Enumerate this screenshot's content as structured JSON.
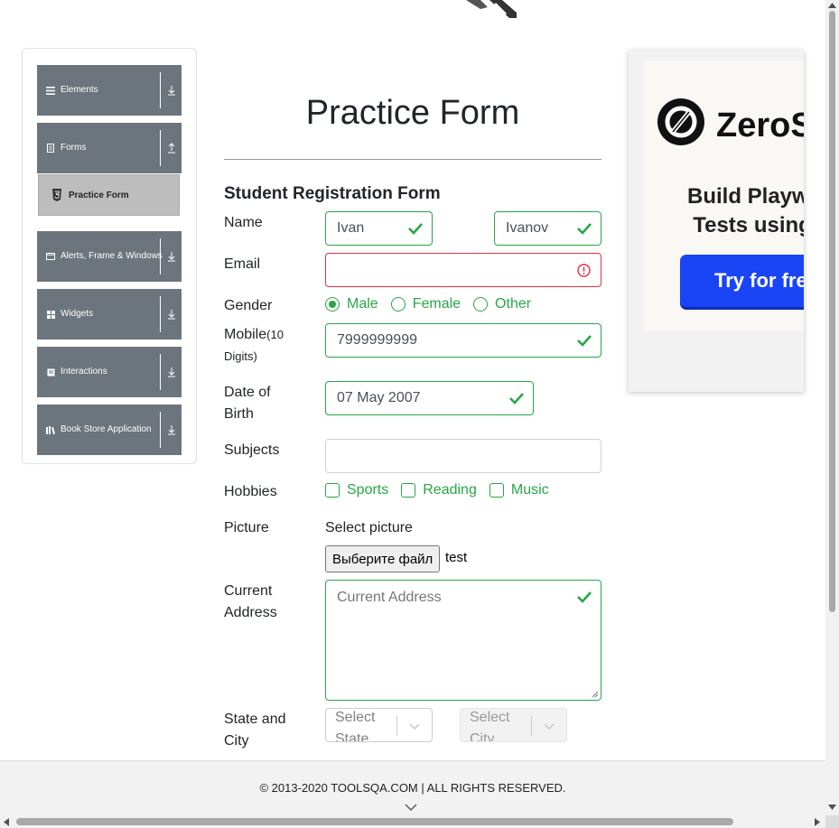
{
  "sidebar": {
    "groups": [
      {
        "label": "Elements",
        "icon": "hamburger-icon",
        "arrow": "down"
      },
      {
        "label": "Forms",
        "icon": "document-icon",
        "arrow": "up"
      },
      {
        "label": "Alerts, Frame & Windows",
        "icon": "window-icon",
        "arrow": "down"
      },
      {
        "label": "Widgets",
        "icon": "grid-icon",
        "arrow": "down"
      },
      {
        "label": "Interactions",
        "icon": "interaction-icon",
        "arrow": "down"
      },
      {
        "label": "Book Store Application",
        "icon": "books-icon",
        "arrow": "down"
      }
    ],
    "active_item": "Practice Form"
  },
  "form": {
    "title": "Practice Form",
    "subtitle": "Student Registration Form",
    "labels": {
      "name": "Name",
      "email": "Email",
      "gender": "Gender",
      "mobile": "Mobile",
      "mobile_hint": "(10 Digits)",
      "dob": "Date of Birth",
      "subjects": "Subjects",
      "hobbies": "Hobbies",
      "picture": "Picture",
      "address": "Current Address",
      "state_city": "State and City"
    },
    "first_name": "Ivan",
    "last_name": "Ivanov",
    "email": "",
    "gender_options": [
      "Male",
      "Female",
      "Other"
    ],
    "gender_selected": "Male",
    "mobile": "7999999999",
    "dob": "07 May 2007",
    "subjects": "",
    "hobbies": [
      "Sports",
      "Reading",
      "Music"
    ],
    "select_picture": "Select picture",
    "file_button": "Выберите файл",
    "file_name": "test",
    "address_placeholder": "Current Address",
    "state_placeholder": "Select State",
    "city_placeholder": "Select City"
  },
  "ad": {
    "brand": "ZeroS",
    "tagline_1": "Build Playwr",
    "tagline_2": "Tests using",
    "cta": "Try for free"
  },
  "footer": {
    "text": "© 2013-2020 TOOLSQA.COM | ALL RIGHTS RESERVED."
  },
  "colors": {
    "valid": "#28a745",
    "invalid": "#dc3545",
    "sidebar": "#6c757d",
    "cta": "#1a45f5"
  }
}
